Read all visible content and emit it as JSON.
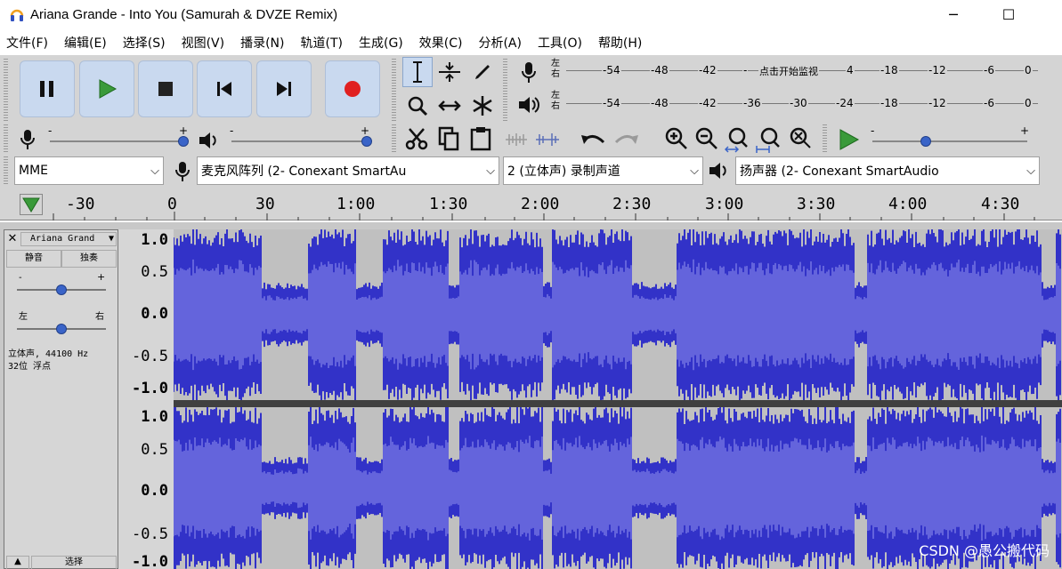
{
  "window": {
    "title": "Ariana Grande - Into You (Samurah & DVZE Remix)",
    "minimize": "─",
    "maximize": "☐"
  },
  "menu": [
    "文件(F)",
    "编辑(E)",
    "选择(S)",
    "视图(V)",
    "播录(N)",
    "轨道(T)",
    "生成(G)",
    "效果(C)",
    "分析(A)",
    "工具(O)",
    "帮助(H)"
  ],
  "transport": {
    "buttons": [
      "pause-icon",
      "play-icon",
      "stop-icon",
      "skip-start-icon",
      "skip-end-icon",
      "record-icon"
    ],
    "accent": "#3a7f3a",
    "record_color": "#e02020"
  },
  "meters": {
    "left_label": "左",
    "right_label": "右",
    "record_ticks": [
      "-54",
      "-48",
      "-42",
      "-",
      "点击开始监视",
      "4",
      "-18",
      "-12",
      "-6",
      "0"
    ],
    "play_ticks": [
      "-54",
      "-48",
      "-42",
      "-36",
      "-30",
      "-24",
      "-18",
      "-12",
      "-6",
      "0"
    ]
  },
  "mixer": {
    "minus": "-",
    "plus": "+"
  },
  "device": {
    "host": "MME",
    "input": "麦克风阵列 (2- Conexant SmartAu",
    "channels": "2 (立体声) 录制声道",
    "output": "扬声器 (2- Conexant SmartAudio"
  },
  "timeline": [
    "-30",
    "0",
    "30",
    "1:00",
    "1:30",
    "2:00",
    "2:30",
    "3:00",
    "3:30",
    "4:00",
    "4:30"
  ],
  "track": {
    "name": "Ariana Grand",
    "mute": "静音",
    "solo": "独奏",
    "gain_minus": "-",
    "gain_plus": "+",
    "pan_left": "左",
    "pan_right": "右",
    "info_line1": "立体声, 44100 Hz",
    "info_line2": "32位 浮点",
    "select": "选择",
    "scale_top": [
      "1.0",
      "0.5",
      "0.0",
      "-0.5",
      "-1.0"
    ],
    "scale_bottom": [
      "1.0",
      "0.5",
      "0.0",
      "-0.5",
      "-1.0"
    ],
    "wave_color": "#3232c8",
    "wave_rms_color": "#6464dc"
  },
  "watermark": "CSDN @愚公搬代码"
}
